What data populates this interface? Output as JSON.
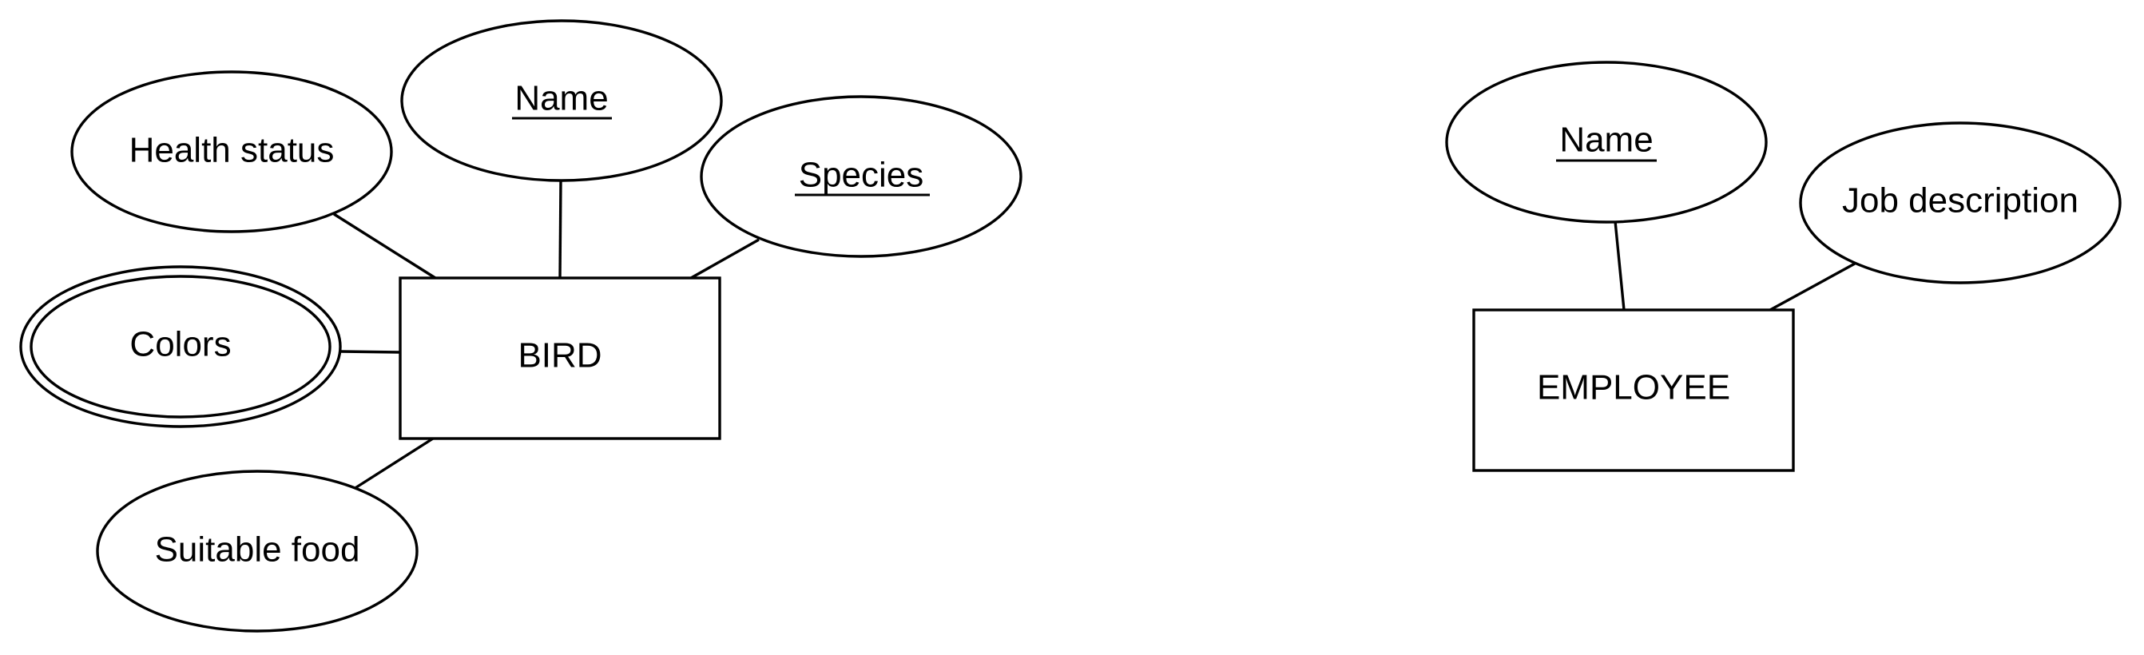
{
  "colors": {
    "stroke": "#000000",
    "background": "#ffffff"
  },
  "entities": [
    {
      "id": "bird",
      "label": "BIRD",
      "attributes": [
        {
          "id": "health-status",
          "label": "Health status",
          "key": false,
          "multivalued": false
        },
        {
          "id": "name",
          "label": "Name",
          "key": true,
          "multivalued": false
        },
        {
          "id": "species",
          "label": "Species",
          "key": true,
          "multivalued": false
        },
        {
          "id": "colors",
          "label": "Colors",
          "key": false,
          "multivalued": true
        },
        {
          "id": "suitable-food",
          "label": "Suitable food",
          "key": false,
          "multivalued": false
        }
      ]
    },
    {
      "id": "employee",
      "label": "EMPLOYEE",
      "attributes": [
        {
          "id": "name",
          "label": "Name",
          "key": true,
          "multivalued": false
        },
        {
          "id": "job-description",
          "label": "Job description",
          "key": false,
          "multivalued": false
        }
      ]
    }
  ]
}
